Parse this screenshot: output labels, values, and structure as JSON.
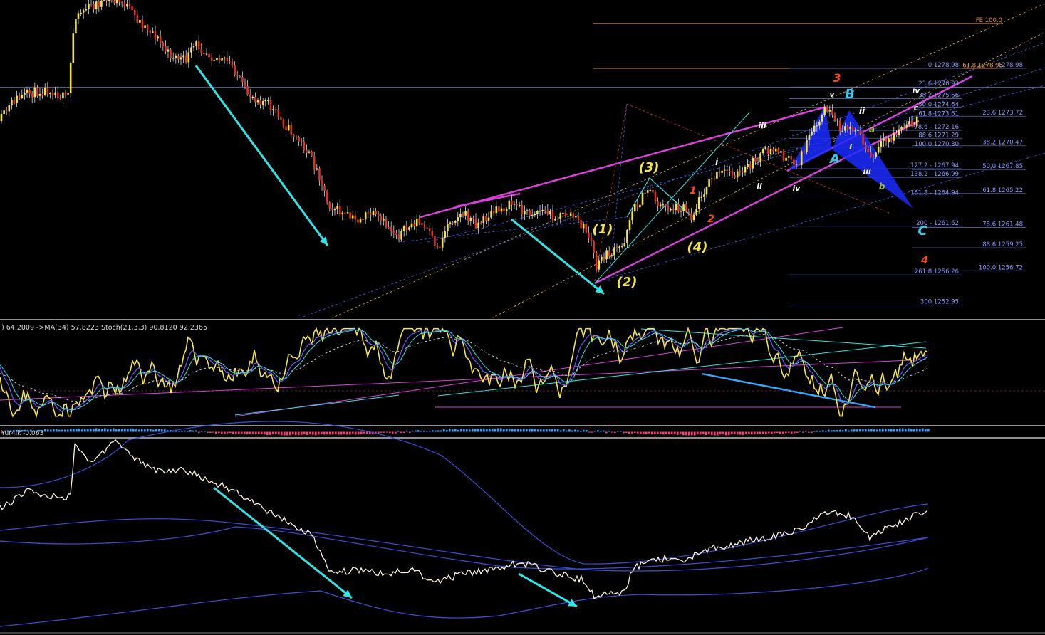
{
  "chart_data": [
    {
      "type": "candlestick",
      "panel": "price",
      "reference_price": 1276.9,
      "y_range": [
        1251.5,
        1286.5
      ],
      "overlays": {
        "colors": {
          "bull": "#f5e542",
          "bear": "#e5301a",
          "wick": "#d9d9d9",
          "channel": "#e040e0",
          "guide": "#2ee6e6",
          "dashed_blue": "#3a5ad8",
          "dashed_orange": "#c8a040",
          "fib_line": "#5566aa",
          "fib_text": "#8a9aff",
          "fe_line": "#e07b3c",
          "pattern_fill": "#1a2bff",
          "wave_yellow": "#f5e542",
          "wave_red": "#ff4a1a",
          "wave_cyan": "#33ccee",
          "wave_white": "#ffffff",
          "wave_green": "#a0c040"
        },
        "fib_levels": [
          {
            "text": "FE 100.0",
            "price": 1283.9,
            "side": "right",
            "color": "#e07b3c"
          },
          {
            "text": "0 1278.98",
            "price": 1278.98,
            "side": "mid"
          },
          {
            "text": "61.8 1278.95",
            "price": 1278.95,
            "side": "right_orange"
          },
          {
            "text": "1278.98",
            "price": 1278.98,
            "side": "far_right"
          },
          {
            "text": "23.6 1276.93",
            "price": 1276.93,
            "side": "mid"
          },
          {
            "text": "38.2 1275.66",
            "price": 1275.66,
            "side": "mid"
          },
          {
            "text": "50.0 1274.64",
            "price": 1274.64,
            "side": "mid"
          },
          {
            "text": "61.8 1273.61",
            "price": 1273.61,
            "side": "mid"
          },
          {
            "text": "23.6 1273.72",
            "price": 1273.72,
            "side": "right"
          },
          {
            "text": "78.6 - 1272.16",
            "price": 1272.16,
            "side": "mid"
          },
          {
            "text": "88.6 1271.29",
            "price": 1271.29,
            "side": "mid"
          },
          {
            "text": "100.0 1270.30",
            "price": 1270.3,
            "side": "mid"
          },
          {
            "text": "38.2 1270.47",
            "price": 1270.47,
            "side": "right"
          },
          {
            "text": "127.2 - 1267.94",
            "price": 1267.94,
            "side": "mid"
          },
          {
            "text": "138.2 - 1266.99",
            "price": 1266.99,
            "side": "mid"
          },
          {
            "text": "50.0 1267.85",
            "price": 1267.85,
            "side": "right"
          },
          {
            "text": "161.8 - 1264.94",
            "price": 1264.94,
            "side": "mid"
          },
          {
            "text": "61.8 1265.22",
            "price": 1265.22,
            "side": "right"
          },
          {
            "text": "200 - 1261.62",
            "price": 1261.62,
            "side": "mid"
          },
          {
            "text": "78.6 1261.48",
            "price": 1261.48,
            "side": "right"
          },
          {
            "text": "88.6 1259.25",
            "price": 1259.25,
            "side": "right"
          },
          {
            "text": "261.8 1256.26",
            "price": 1256.26,
            "side": "mid"
          },
          {
            "text": "100.0 1256.72",
            "price": 1256.72,
            "side": "right"
          },
          {
            "text": "300 1252.95",
            "price": 1252.95,
            "side": "mid"
          }
        ],
        "wave_labels": [
          {
            "text": "(1)",
            "color": "wave_yellow"
          },
          {
            "text": "(2)",
            "color": "wave_yellow"
          },
          {
            "text": "(3)",
            "color": "wave_yellow"
          },
          {
            "text": "(4)",
            "color": "wave_yellow"
          },
          {
            "text": "1",
            "color": "wave_red"
          },
          {
            "text": "2",
            "color": "wave_red"
          },
          {
            "text": "3",
            "color": "wave_red"
          },
          {
            "text": "4",
            "color": "wave_red"
          },
          {
            "text": "i",
            "color": "wave_white"
          },
          {
            "text": "ii",
            "color": "wave_white"
          },
          {
            "text": "iii",
            "color": "wave_white"
          },
          {
            "text": "iv",
            "color": "wave_white"
          },
          {
            "text": "v",
            "color": "wave_white"
          },
          {
            "text": "ii",
            "color": "wave_white"
          },
          {
            "text": "i",
            "color": "wave_white"
          },
          {
            "text": "iii",
            "color": "wave_white"
          },
          {
            "text": "iv",
            "color": "wave_white"
          },
          {
            "text": "a",
            "color": "wave_green"
          },
          {
            "text": "b",
            "color": "wave_green"
          },
          {
            "text": "c",
            "color": "wave_white"
          },
          {
            "text": "A",
            "color": "wave_cyan"
          },
          {
            "text": "B",
            "color": "wave_cyan"
          },
          {
            "text": "C",
            "color": "wave_cyan"
          }
        ]
      }
    },
    {
      "type": "line",
      "panel": "oscillator",
      "header": ") 64.2009  ->MA(34) 57.8223  Stoch(21,3,3) 90.8120 92.2365",
      "y_range": [
        0,
        100
      ],
      "series": [
        {
          "id": "fast",
          "color": "#f5e542",
          "width": 1.6
        },
        {
          "id": "slow",
          "color": "#6a5aff",
          "width": 1.2
        },
        {
          "id": "signal",
          "color": "#2ee6e6",
          "width": 1.0
        },
        {
          "id": "ma",
          "color": "#cccccc",
          "width": 1.0,
          "dashed": true
        }
      ]
    },
    {
      "type": "bar",
      "panel": "histogram",
      "header": "Yur4ik -0.063",
      "colors": {
        "up": "#3aa0ff",
        "down": "#ff3a7a"
      }
    },
    {
      "type": "line",
      "panel": "envelope",
      "series": [
        {
          "id": "price",
          "color": "#fff4e0",
          "width": 1.3
        },
        {
          "id": "band_outer_top",
          "color": "#3a50d8"
        },
        {
          "id": "band_mid",
          "color": "#3a50d8"
        },
        {
          "id": "band_outer_bot",
          "color": "#3a50d8"
        }
      ]
    }
  ]
}
